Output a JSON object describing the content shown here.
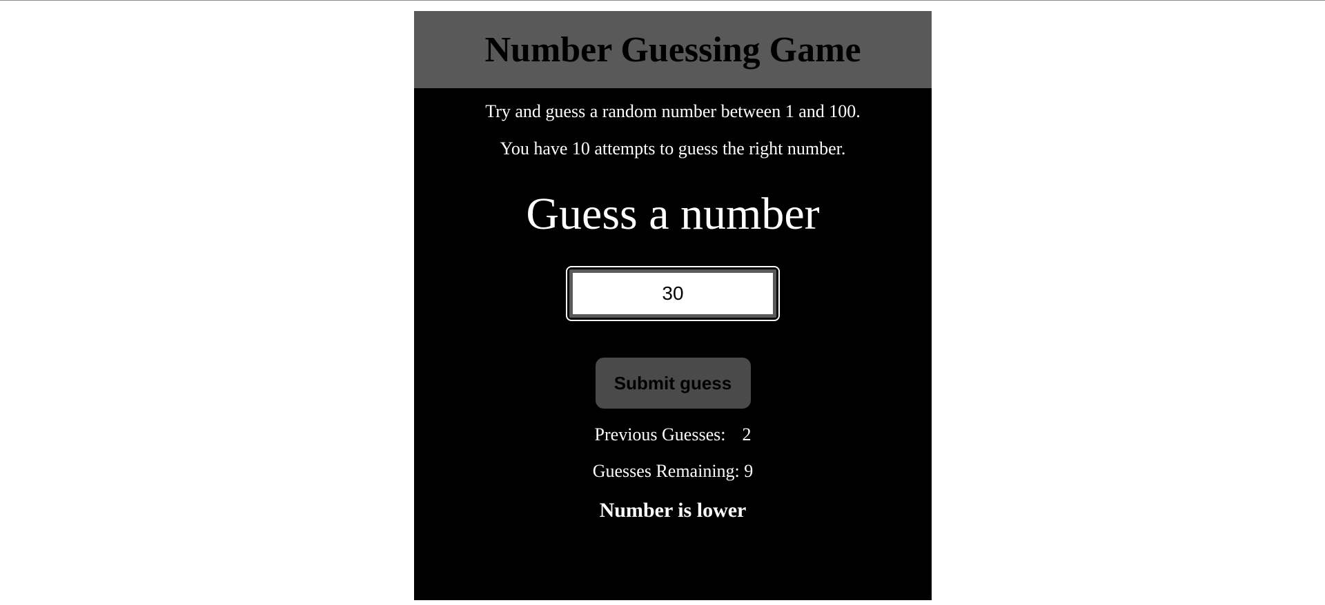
{
  "game": {
    "title": "Number Guessing Game",
    "intro_line_1": "Try and guess a random number between 1 and 100.",
    "intro_line_2": "You have 10 attempts to guess the right number.",
    "prompt_heading": "Guess a number",
    "guess_input_value": "30",
    "submit_label": "Submit guess",
    "previous_guesses_label": "Previous Guesses:",
    "previous_guesses_value": "2",
    "remaining_label": "Guesses Remaining:",
    "remaining_value": "9",
    "result_message": "Number is lower"
  },
  "colors": {
    "header_bg": "#595959",
    "panel_bg": "#000000",
    "button_bg": "#4a4a4a"
  }
}
